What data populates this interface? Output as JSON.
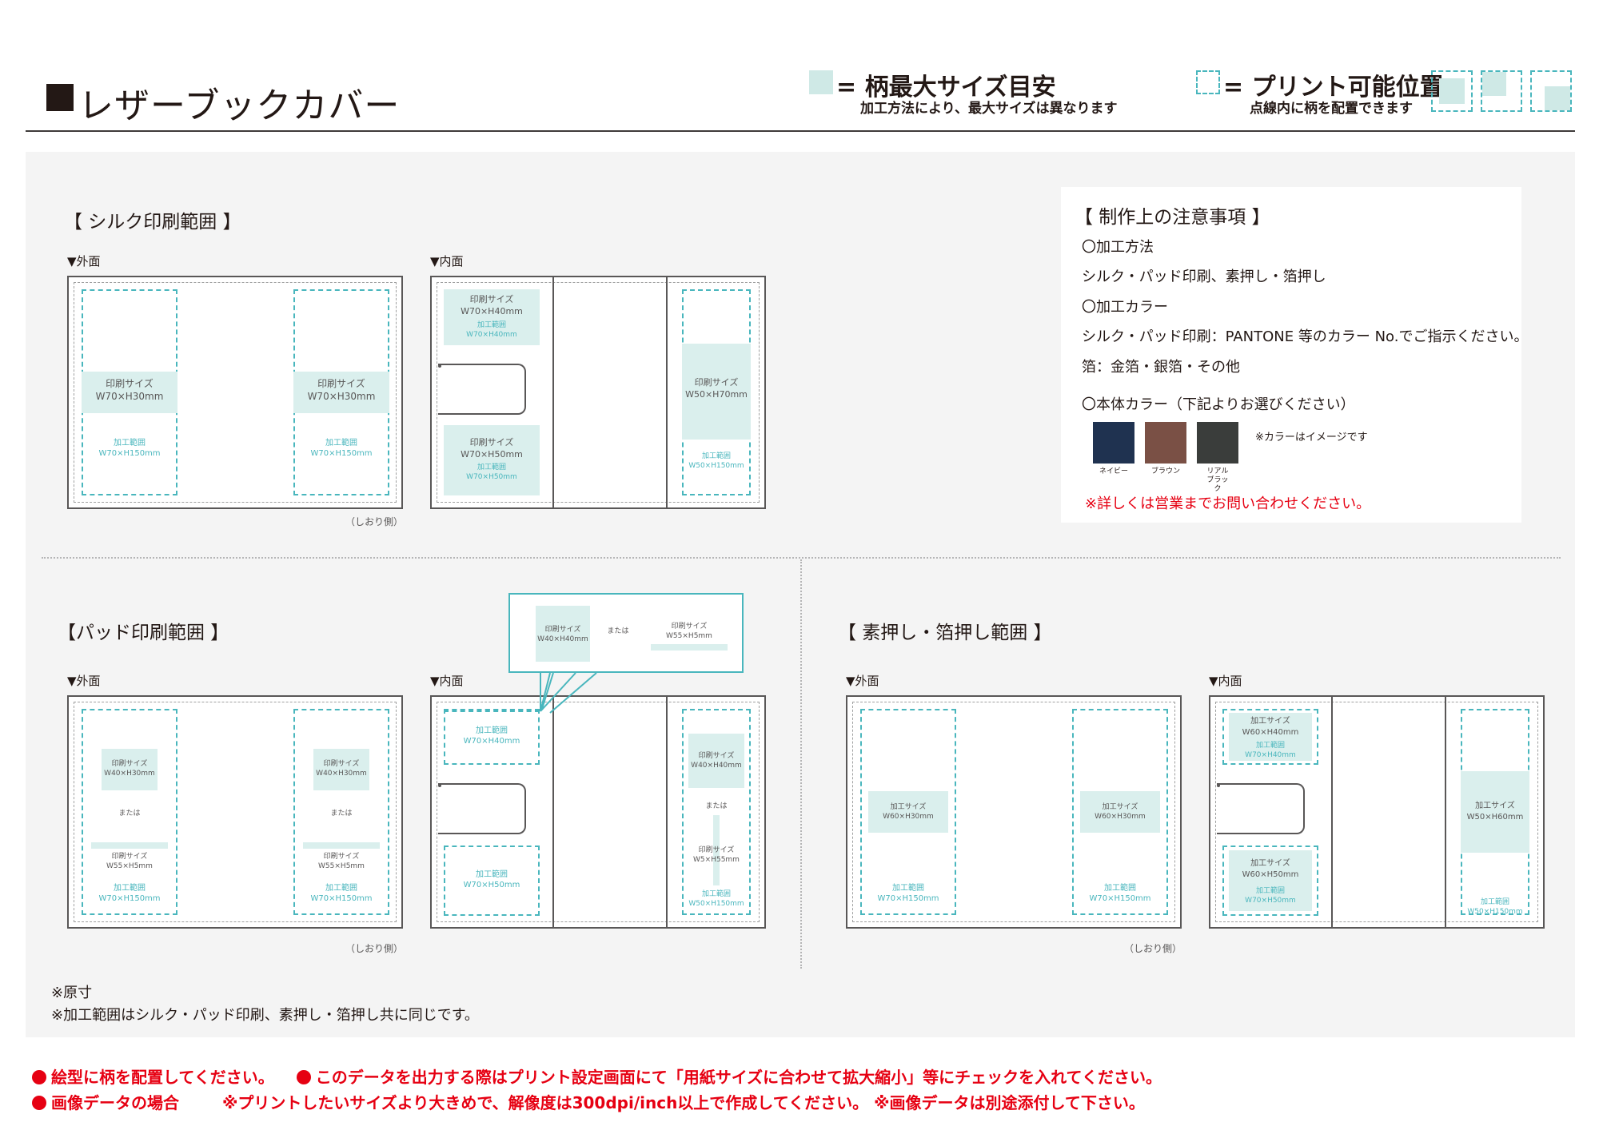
{
  "header": {
    "title": "レザーブックカバー",
    "legend1_head": "= 柄最大サイズ目安",
    "legend1_sub": "加工方法により、最大サイズは異なります",
    "legend2_head": "= プリント可能位置",
    "legend2_sub": "点線内に柄を配置できます"
  },
  "silk": {
    "title": "【 シルク印刷範囲 】",
    "outer_label": "▼外面",
    "inner_label": "▼内面",
    "print_size": "印刷サイズ",
    "outer_size": "W70×H30mm",
    "area_label": "加工範囲",
    "outer_area": "W70×H150mm",
    "inner_top_size": "W70×H40mm",
    "inner_top_area": "W70×H40mm",
    "inner_bottom_size": "W70×H50mm",
    "inner_bottom_area": "W70×H50mm",
    "inner_right_size": "W50×H70mm",
    "inner_right_area": "W50×H150mm",
    "bookmark_side": "（しおり側）"
  },
  "notes": {
    "title": "【 制作上の注意事項 】",
    "method_head": "〇加工方法",
    "method_body": "シルク・パッド印刷、素押し・箔押し",
    "color_head": "〇加工カラー",
    "color_body": "シルク・パッド印刷：PANTONE 等のカラー No.でご指示ください。",
    "foil_body": "箔：金箔・銀箔・その他",
    "body_color_head": "〇本体カラー（下記よりお選びください）",
    "swatches": [
      {
        "name": "ネイビー",
        "color": "#1f3250"
      },
      {
        "name": "ブラウン",
        "color": "#7a5045"
      },
      {
        "name": "リアル ブラック",
        "color": "#3a3d3b"
      }
    ],
    "swatch_note": "※カラーはイメージです",
    "contact": "※詳しくは営業までお問い合わせください。"
  },
  "pad": {
    "title": "【パッド印刷範囲 】",
    "outer_label": "▼外面",
    "inner_label": "▼内面",
    "print_size": "印刷サイズ",
    "size_a": "W40×H30mm",
    "or": "または",
    "size_b": "W55×H5mm",
    "area_label": "加工範囲",
    "outer_area": "W70×H150mm",
    "inner_top_area": "W70×H40mm",
    "inner_bottom_area": "W70×H50mm",
    "inner_right_size_a": "W40×H40mm",
    "inner_right_size_b": "W5×H55mm",
    "inner_right_area": "W50×H150mm",
    "callout_size_a": "W40×H40mm",
    "callout_size_b": "W55×H5mm",
    "bookmark_side": "（しおり側）"
  },
  "stamp": {
    "title": "【 素押し・箔押し範囲 】",
    "outer_label": "▼外面",
    "inner_label": "▼内面",
    "work_size": "加工サイズ",
    "outer_size": "W60×H30mm",
    "area_label": "加工範囲",
    "outer_area": "W70×H150mm",
    "inner_top_size": "W60×H40mm",
    "inner_top_area": "W70×H40mm",
    "inner_bottom_size": "W60×H50mm",
    "inner_bottom_area": "W70×H50mm",
    "inner_right_size": "W50×H60mm",
    "inner_right_area": "W50×H150mm",
    "bookmark_side": "（しおり側）"
  },
  "bottom_notes": {
    "original_size": "※原寸",
    "same_range": "※加工範囲はシルク・パッド印刷、素押し・箔押し共に同じです。"
  },
  "footer": {
    "line1_a": "絵型に柄を配置してください。",
    "line1_b": "このデータを出力する際はプリント設定画面にて「用紙サイズに合わせて拡大縮小」等にチェックを入れてください。",
    "line2_a": "画像データの場合",
    "line2_b": "※プリントしたいサイズより大きめで、解像度は300dpi/inch以上で作成してください。 ※画像データは別途添付して下さい。"
  }
}
